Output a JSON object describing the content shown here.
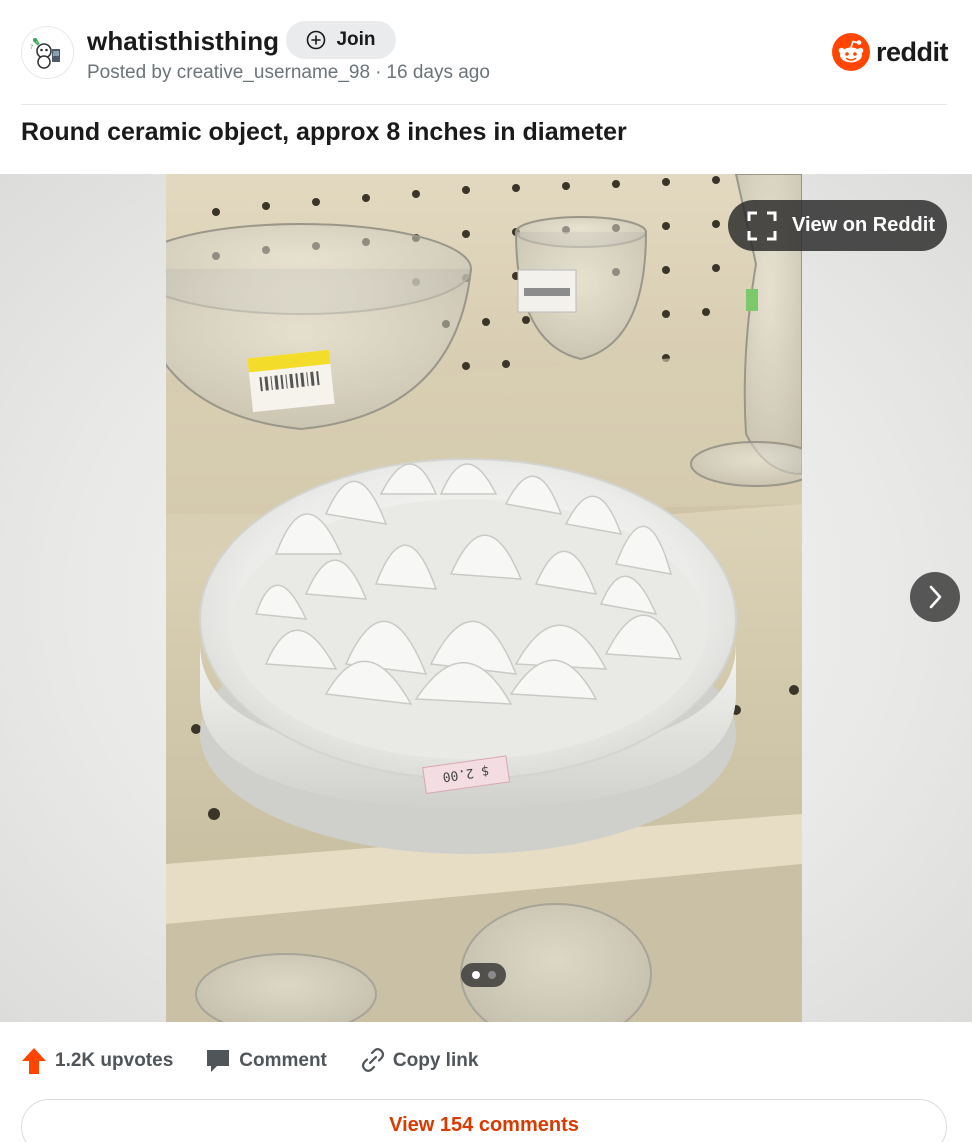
{
  "header": {
    "subreddit": "whatisthisthing",
    "join_label": "Join",
    "posted_by_prefix": "Posted by",
    "username": "creative_username_98",
    "separator": "·",
    "time_ago": "16 days ago",
    "brand": "reddit"
  },
  "post": {
    "title": "Round ceramic object, approx 8 inches in diameter",
    "price_tag_text": "$ 2.00"
  },
  "media": {
    "view_on_reddit_label": "View on Reddit",
    "image_count": 2,
    "active_index": 1
  },
  "actions": {
    "upvotes_label": "1.2K upvotes",
    "comment_label": "Comment",
    "copy_link_label": "Copy link",
    "view_comments_label": "View 154 comments"
  },
  "colors": {
    "brand_orange": "#ff4500",
    "link_orange": "#d93a00",
    "meta_gray": "#6a7479"
  },
  "icons": {
    "join": "plus-circle-icon",
    "expand": "expand-icon",
    "next": "chevron-right-icon",
    "upvote": "upvote-arrow-icon",
    "comment": "comment-bubble-icon",
    "copy_link": "link-icon",
    "brand": "reddit-snoo-icon"
  }
}
